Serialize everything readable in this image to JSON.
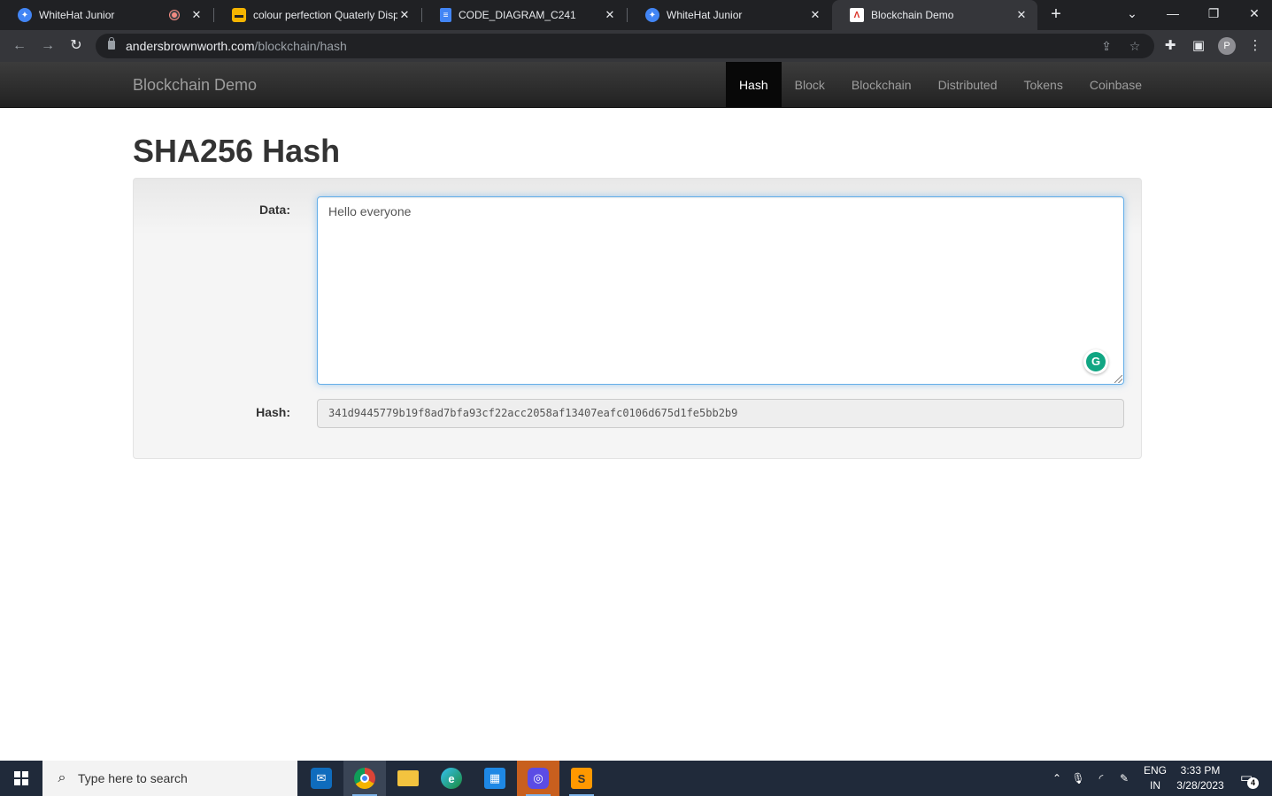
{
  "browser": {
    "tabs": [
      {
        "title": "WhiteHat Junior",
        "icon": "whitehat-favicon"
      },
      {
        "title": "colour perfection Quaterly Disp",
        "icon": "slides-favicon"
      },
      {
        "title": "CODE_DIAGRAM_C241",
        "icon": "docs-favicon"
      },
      {
        "title": "WhiteHat Junior",
        "icon": "whitehat-favicon"
      },
      {
        "title": "Blockchain Demo",
        "icon": "blockchain-demo-favicon"
      }
    ],
    "url_host": "andersbrownworth.com",
    "url_path": "/blockchain/hash",
    "profile_initial": "P"
  },
  "site": {
    "brand": "Blockchain Demo",
    "nav": [
      "Hash",
      "Block",
      "Blockchain",
      "Distributed",
      "Tokens",
      "Coinbase"
    ],
    "active_nav": "Hash"
  },
  "main": {
    "title": "SHA256 Hash",
    "data_label": "Data:",
    "data_value": "Hello everyone",
    "hash_label": "Hash:",
    "hash_value": "341d9445779b19f8ad7bfa93cf22acc2058af13407eafc0106d675d1fe5bb2b9"
  },
  "taskbar": {
    "search_placeholder": "Type here to search",
    "lang_line1": "ENG",
    "lang_line2": "IN",
    "time": "3:33 PM",
    "date": "3/28/2023",
    "notification_count": "4"
  },
  "colors": {
    "navbar": "#222222",
    "active_nav": "#080808",
    "focus_border": "#66afe9",
    "grammarly": "#11a683"
  }
}
